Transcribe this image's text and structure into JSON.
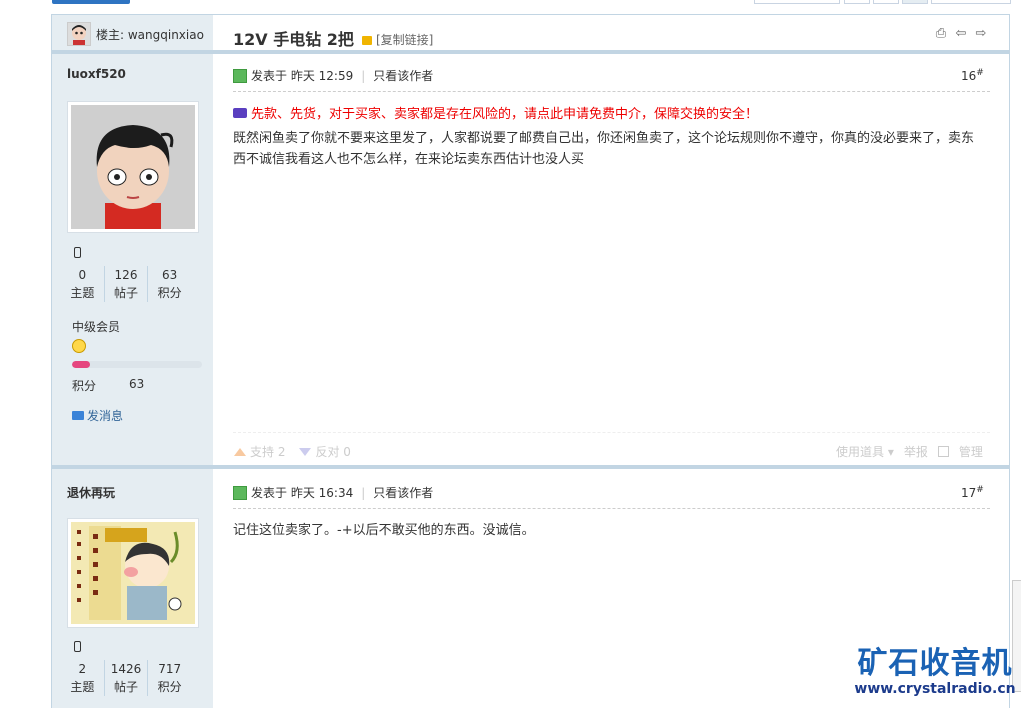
{
  "thread": {
    "owner_label": "楼主: wangqinxiao",
    "title": "12V 手电钻 2把",
    "copy_link": "[复制链接]",
    "header_icons": [
      "print-icon",
      "prev-thread-icon",
      "next-thread-icon"
    ]
  },
  "posts": [
    {
      "username": "luoxf520",
      "avatar": "cartoon-boy-avatar",
      "stats": [
        {
          "value": "0",
          "label": "主题"
        },
        {
          "value": "126",
          "label": "帖子"
        },
        {
          "value": "63",
          "label": "积分"
        }
      ],
      "level": "中级会员",
      "level_progress": 0.14,
      "points_label": "积分",
      "points_value": "63",
      "send_message": "发消息",
      "posted": "发表于 昨天 12:59",
      "author_only": "只看该作者",
      "floor": "16",
      "floor_mark": "#",
      "notice": "先款、先货，对于买家、卖家都是存在风险的，请点此申请免费中介，保障交换的安全！",
      "content": "既然闲鱼卖了你就不要来这里发了，人家都说要了邮费自己出，你还闲鱼卖了，这个论坛规则你不遵守，你真的没必要来了，卖东西不诚信我看这人也不怎么样，在来论坛卖东西估计也没人买",
      "support": "支持 2",
      "oppose": "反对 0",
      "use_tool": "使用道具",
      "report": "举报",
      "manage": "管理"
    },
    {
      "username": "退休再玩",
      "avatar": "cartoon-child-poem-avatar",
      "stats": [
        {
          "value": "2",
          "label": "主题"
        },
        {
          "value": "1426",
          "label": "帖子"
        },
        {
          "value": "717",
          "label": "积分"
        }
      ],
      "posted": "发表于 昨天 16:34",
      "author_only": "只看该作者",
      "floor": "17",
      "floor_mark": "#",
      "content": "记住这位卖家了。-+以后不敢买他的东西。没诚信。"
    }
  ],
  "watermark": {
    "cn": "矿石收音机",
    "en": "www.crystalradio.cn"
  },
  "colors": {
    "sidebar_bg": "#e5edf2",
    "border": "#c2d5e3",
    "notice_red": "#ee0000",
    "level_bar": "#e5467f",
    "brand_blue": "#1a62b4"
  }
}
